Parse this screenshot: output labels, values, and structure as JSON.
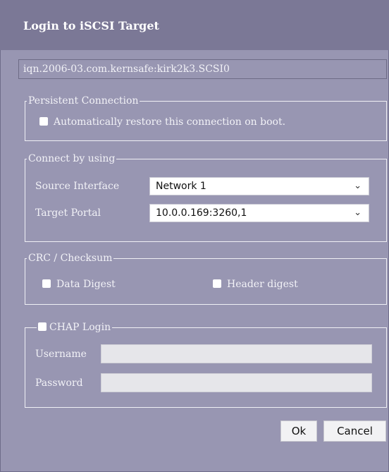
{
  "dialog": {
    "title": "Login to iSCSI Target",
    "target_name": "iqn.2006-03.com.kernsafe:kirk2k3.SCSI0"
  },
  "persistent": {
    "legend": "Persistent Connection",
    "restore_label": "Automatically restore this connection on boot."
  },
  "connect": {
    "legend": "Connect by using",
    "source_label": "Source Interface",
    "source_value": "Network 1",
    "portal_label": "Target Portal",
    "portal_value": "10.0.0.169:3260,1"
  },
  "crc": {
    "legend": "CRC / Checksum",
    "data_digest": "Data Digest",
    "header_digest": "Header digest"
  },
  "chap": {
    "legend": "CHAP Login",
    "username_label": "Username",
    "password_label": "Password"
  },
  "buttons": {
    "ok": "Ok",
    "cancel": "Cancel"
  },
  "icons": {
    "dropdown": "chevron-down-icon"
  },
  "colors": {
    "titlebar": "#7b7896",
    "dialog_bg": "#9896b2"
  }
}
